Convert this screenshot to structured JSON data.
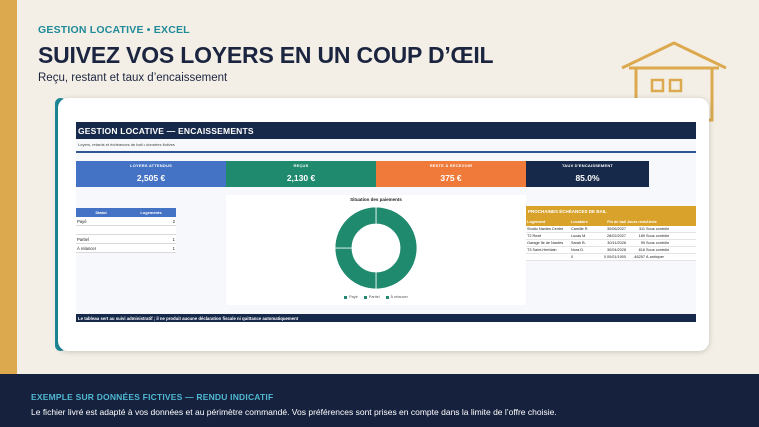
{
  "header": {
    "eyebrow": "GESTION LOCATIVE • EXCEL",
    "title": "SUIVEZ VOS LOYERS EN UN COUP D’ŒIL",
    "subtitle": "Reçu, restant et taux d’encaissement"
  },
  "colors": {
    "accent_teal": "#1f8a98",
    "gold": "#dca94f",
    "navy": "#16294a",
    "kpi_blue": "#4472c4",
    "kpi_green": "#1f8a6e",
    "kpi_orange": "#f07a3a",
    "kpi_navy": "#16294a"
  },
  "icons": [
    "house-outline-icon"
  ],
  "sheet": {
    "title": "GESTION LOCATIVE — ENCAISSEMENTS",
    "subtitle": "Loyers, retards et échéances de bail • données fictives",
    "kpis": [
      {
        "label": "LOYERS ATTENDUS",
        "value": "2,505 €"
      },
      {
        "label": "REÇUS",
        "value": "2,130 €"
      },
      {
        "label": "RESTE À RECEVOIR",
        "value": "375 €"
      },
      {
        "label": "TAUX D'ENCAISSEMENT",
        "value": "85.0%"
      }
    ],
    "status_table": {
      "headers": [
        "Statut",
        "Logements"
      ],
      "rows": [
        [
          "Payé",
          "2"
        ],
        [
          "",
          ""
        ],
        [
          "Partiel",
          "1"
        ],
        [
          "À relancer",
          "1"
        ]
      ]
    },
    "due_table": {
      "title": "PROCHAINES ÉCHÉANCES DE BAIL",
      "headers": [
        "Logement",
        "Locataire",
        "Fin de bail",
        "Jours restants",
        "Alerte"
      ],
      "rows": [
        [
          "Studio Nantes Centre",
          "Camille R.",
          "30/06/2027",
          "311",
          "Sous contrôle"
        ],
        [
          "T2 Rezé",
          "Lucas M.",
          "28/02/2027",
          "189",
          "Sous contrôle"
        ],
        [
          "Garage Île de Nantes",
          "Sarah B.",
          "30/11/2026",
          "99",
          "Sous contrôle"
        ],
        [
          "T3 Saint-Herblain",
          "Nora D.",
          "30/04/2028",
          "616",
          "Sous contrôle"
        ],
        [
          "",
          "0",
          "0 00/01/1900",
          "-46257",
          "À anticiper"
        ]
      ]
    },
    "footnote": "Le tableau sert au suivi administratif ; il ne produit aucune déclaration fiscale ni quittance automatiquement"
  },
  "chart_data": {
    "type": "pie",
    "title": "Situation des paiements",
    "categories": [
      "Payé",
      "Partiel",
      "À relancer"
    ],
    "values": [
      2,
      1,
      1
    ],
    "colors": [
      "#1f8a6e",
      "#1f8a6e",
      "#1f8a6e"
    ],
    "legend": "bottom"
  },
  "banner": {
    "title": "EXEMPLE SUR DONNÉES FICTIVES — RENDU INDICATIF",
    "text": "Le fichier livré est adapté à vos données et au périmètre commandé. Vos préférences sont prises en compte dans la limite de l’offre choisie."
  }
}
